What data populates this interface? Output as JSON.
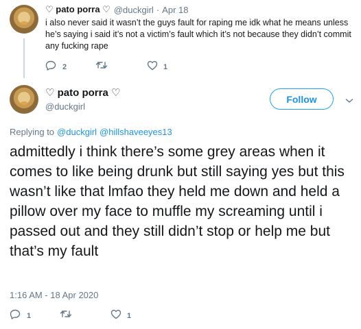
{
  "parent_tweet": {
    "display_name": "♡ pato porra ♡",
    "handle": "@duckgirl",
    "separator": "·",
    "date": "Apr 18",
    "text": "i also never said it wasn’t the guys fault for raping me idk what he means unless he’s saying i said it’s not a victim’s fault which it’s not because they didn’t commit any fucking rape",
    "reply_count": "2",
    "like_count": "1"
  },
  "main_tweet": {
    "display_name": "♡ pato porra ♡",
    "handle": "@duckgirl",
    "follow_label": "Follow",
    "replying_to_label": "Replying to",
    "replying_to_user1": "@duckgirl",
    "replying_to_user2": "@hillshaveeyes13",
    "text": "admittedly i think there’s some grey areas when it comes to like being drunk but still saying yes but this wasn’t like that lmfao they held me down and held a pillow over my face to muffle my screaming until i passed out and they still didn’t stop or help me but that’s my fault",
    "timestamp": "1:16 AM - 18 Apr 2020",
    "reply_count": "1",
    "like_count": "1"
  },
  "colors": {
    "accent": "#1da1f2",
    "link": "#1b95e0",
    "muted": "#657786",
    "text": "#14171a"
  },
  "icons": [
    "reply-icon",
    "retweet-icon",
    "like-icon",
    "chevron-down-icon"
  ]
}
